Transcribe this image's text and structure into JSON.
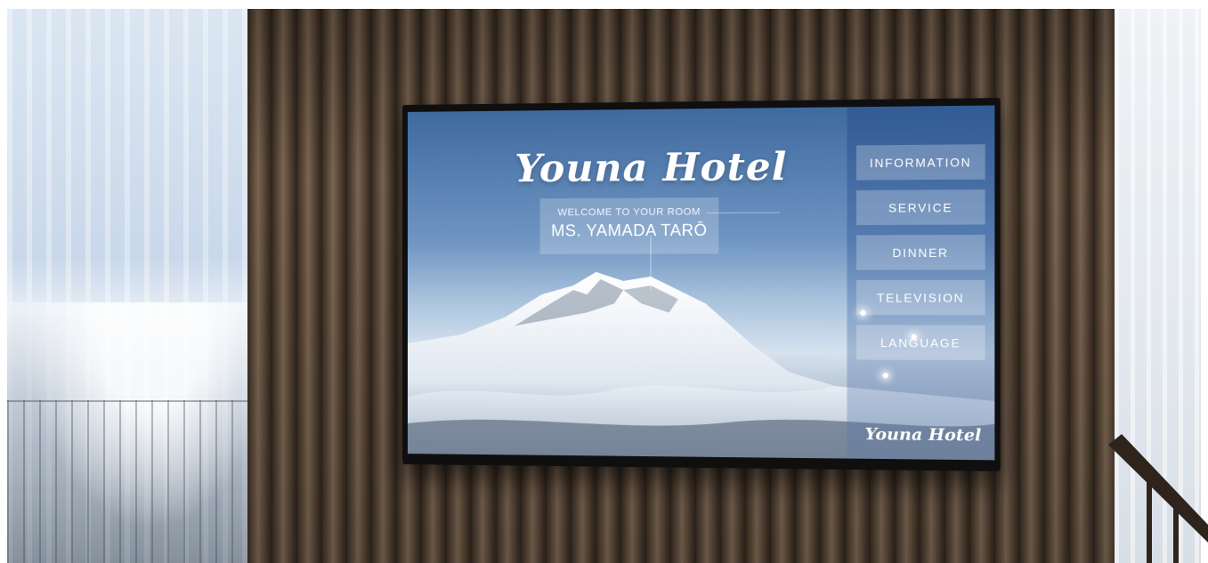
{
  "tv_screen": {
    "brand_title": "Youna Hotel",
    "welcome_text": "WELCOME TO YOUR ROOM",
    "guest_name": "MS. YAMADA TARŌ",
    "menu": [
      {
        "label": "INFORMATION"
      },
      {
        "label": "SERVICE"
      },
      {
        "label": "DINNER"
      },
      {
        "label": "TELEVISION"
      },
      {
        "label": "LANGUAGE"
      }
    ],
    "footer_brand": "Youna Hotel"
  },
  "colors": {
    "curtain": "#4a3a2c",
    "screen_sky": "#3f6aa0",
    "menu_button_bg": "rgba(255,255,255,0.25)"
  }
}
